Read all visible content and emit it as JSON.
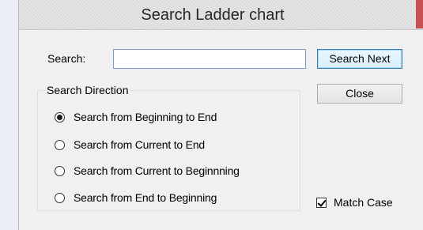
{
  "window": {
    "title": "Search Ladder chart",
    "accent_close": "#c75050"
  },
  "search": {
    "label": "Search:",
    "value": "",
    "placeholder": ""
  },
  "buttons": {
    "search_next": "Search Next",
    "close": "Close"
  },
  "direction": {
    "legend": "Search Direction",
    "options": [
      {
        "label": "Search from Beginning to End",
        "checked": true
      },
      {
        "label": "Search from Current to End",
        "checked": false
      },
      {
        "label": "Search from Current to Beginnning",
        "checked": false
      },
      {
        "label": "Search from End to Beginning",
        "checked": false
      }
    ]
  },
  "match_case": {
    "label": "Match Case",
    "checked": true
  }
}
